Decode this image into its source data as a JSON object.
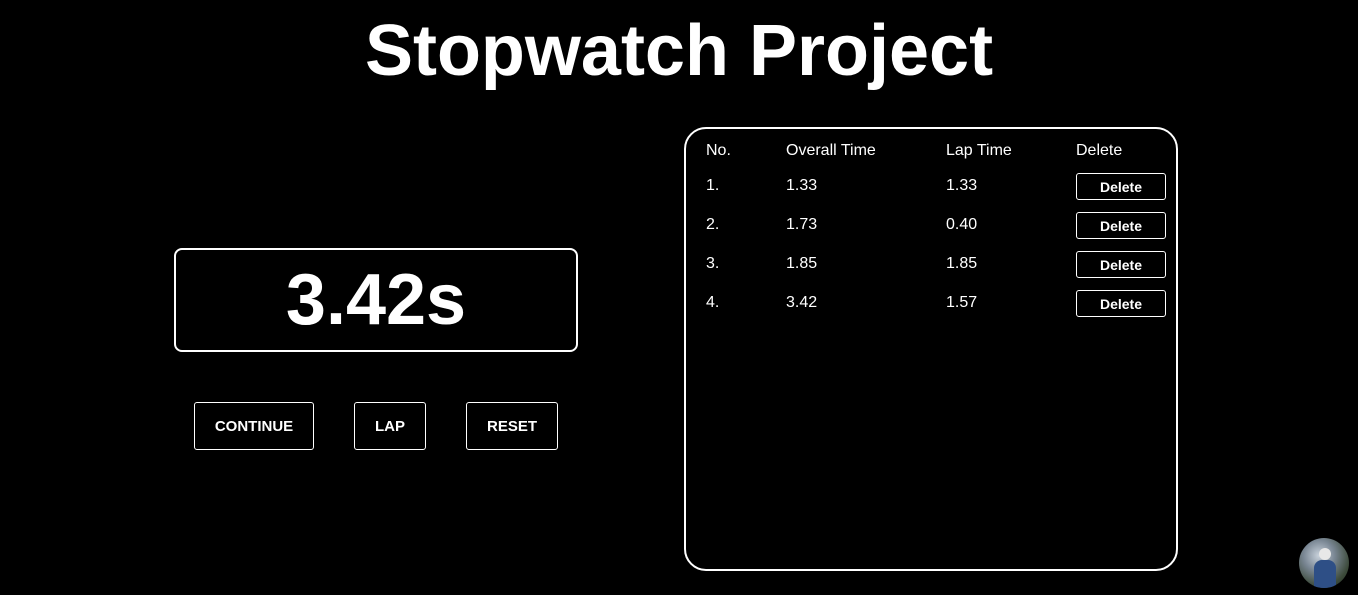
{
  "page": {
    "title": "Stopwatch Project"
  },
  "timer": {
    "display": "3.42s"
  },
  "controls": {
    "continue_label": "CONTINUE",
    "lap_label": "LAP",
    "reset_label": "RESET"
  },
  "laps": {
    "headers": {
      "no": "No.",
      "overall": "Overall Time",
      "lap": "Lap Time",
      "delete": "Delete"
    },
    "delete_label": "Delete",
    "rows": [
      {
        "no": "1.",
        "overall": "1.33",
        "lap": "1.33"
      },
      {
        "no": "2.",
        "overall": "1.73",
        "lap": "0.40"
      },
      {
        "no": "3.",
        "overall": "1.85",
        "lap": "1.85"
      },
      {
        "no": "4.",
        "overall": "3.42",
        "lap": "1.57"
      }
    ]
  },
  "theme": {
    "background": "#000000",
    "foreground": "#ffffff"
  }
}
